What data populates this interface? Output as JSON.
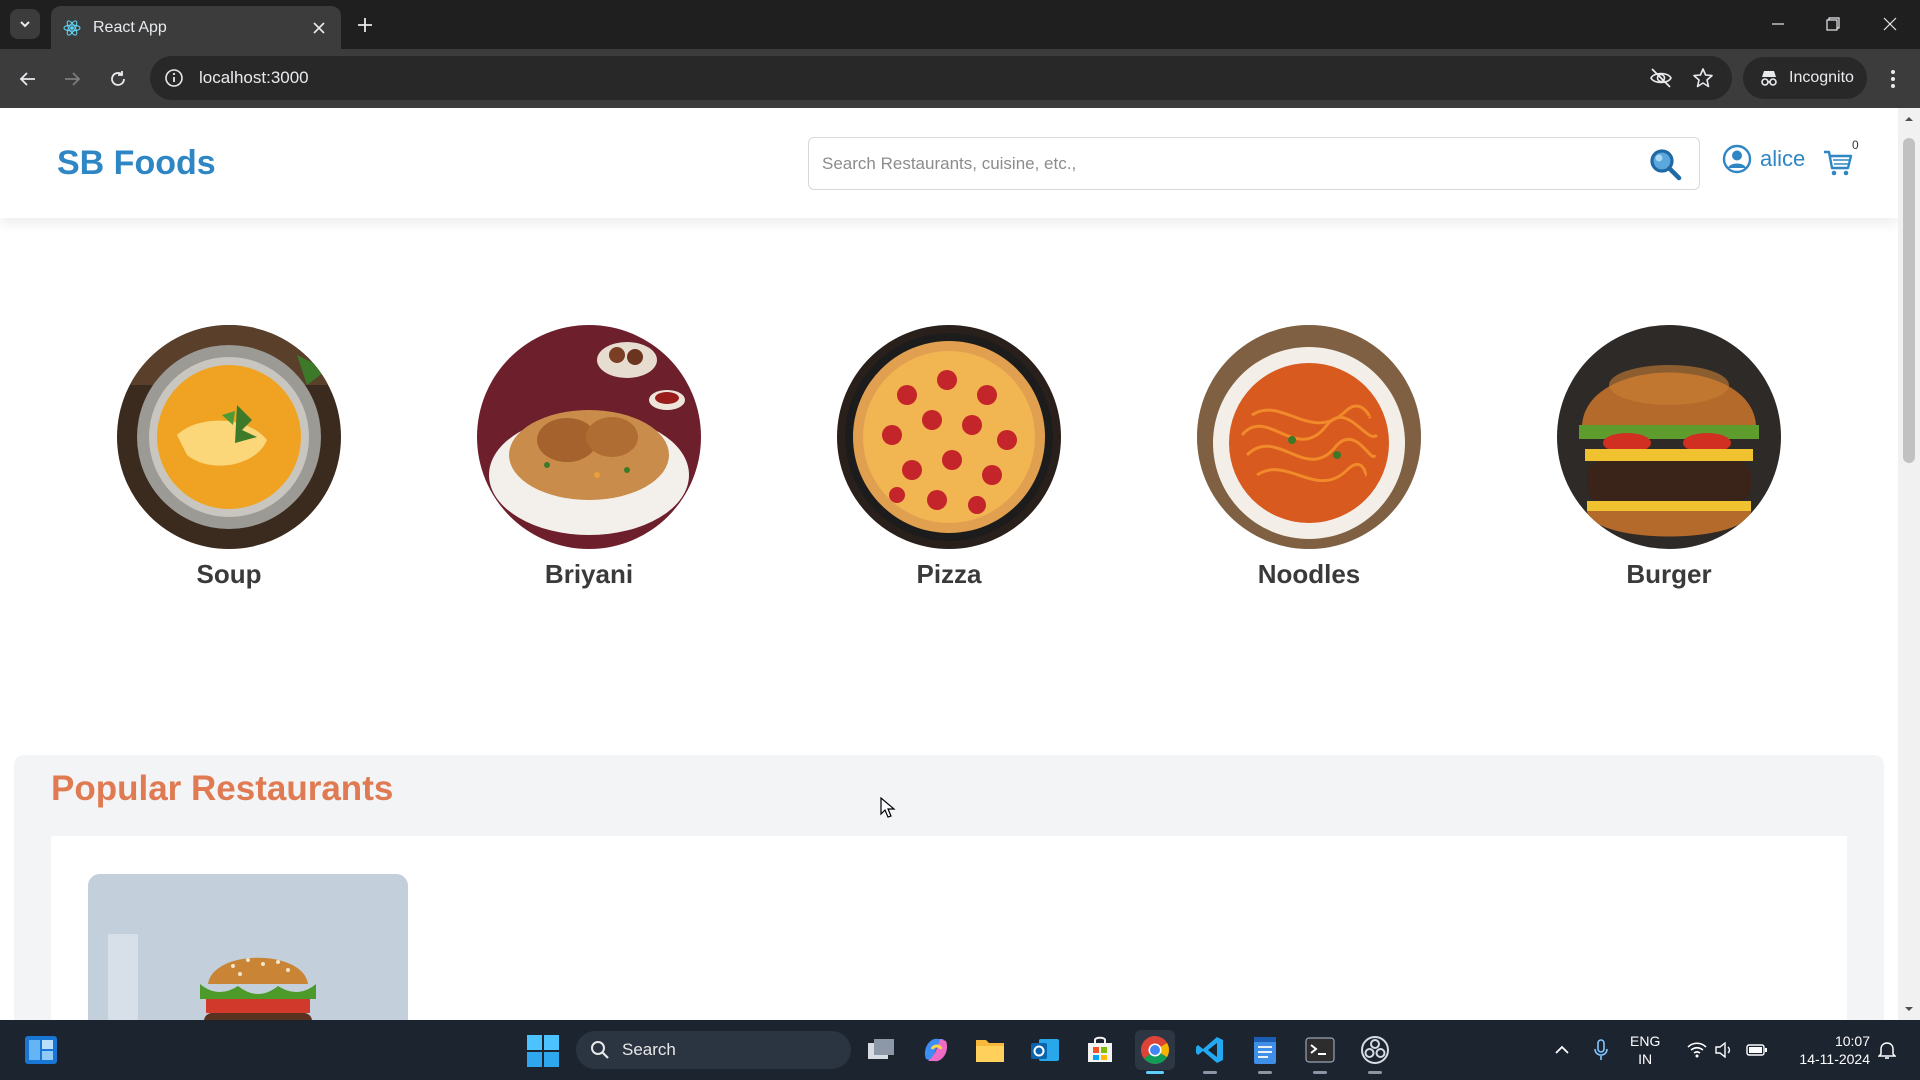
{
  "browser": {
    "tab_title": "React App",
    "url": "localhost:3000",
    "incognito_label": "Incognito"
  },
  "site": {
    "brand": "SB Foods",
    "search_placeholder": "Search Restaurants, cuisine, etc.,",
    "user_name": "alice",
    "cart_count": "0"
  },
  "categories": [
    {
      "label": "Soup"
    },
    {
      "label": "Briyani"
    },
    {
      "label": "Pizza"
    },
    {
      "label": "Noodles"
    },
    {
      "label": "Burger"
    }
  ],
  "popular": {
    "title": "Popular Restaurants"
  },
  "taskbar": {
    "search_label": "Search",
    "lang_line1": "ENG",
    "lang_line2": "IN",
    "time": "10:07",
    "date": "14-11-2024"
  },
  "colors": {
    "brand": "#2f86c4",
    "popular_title": "#e07a52"
  }
}
